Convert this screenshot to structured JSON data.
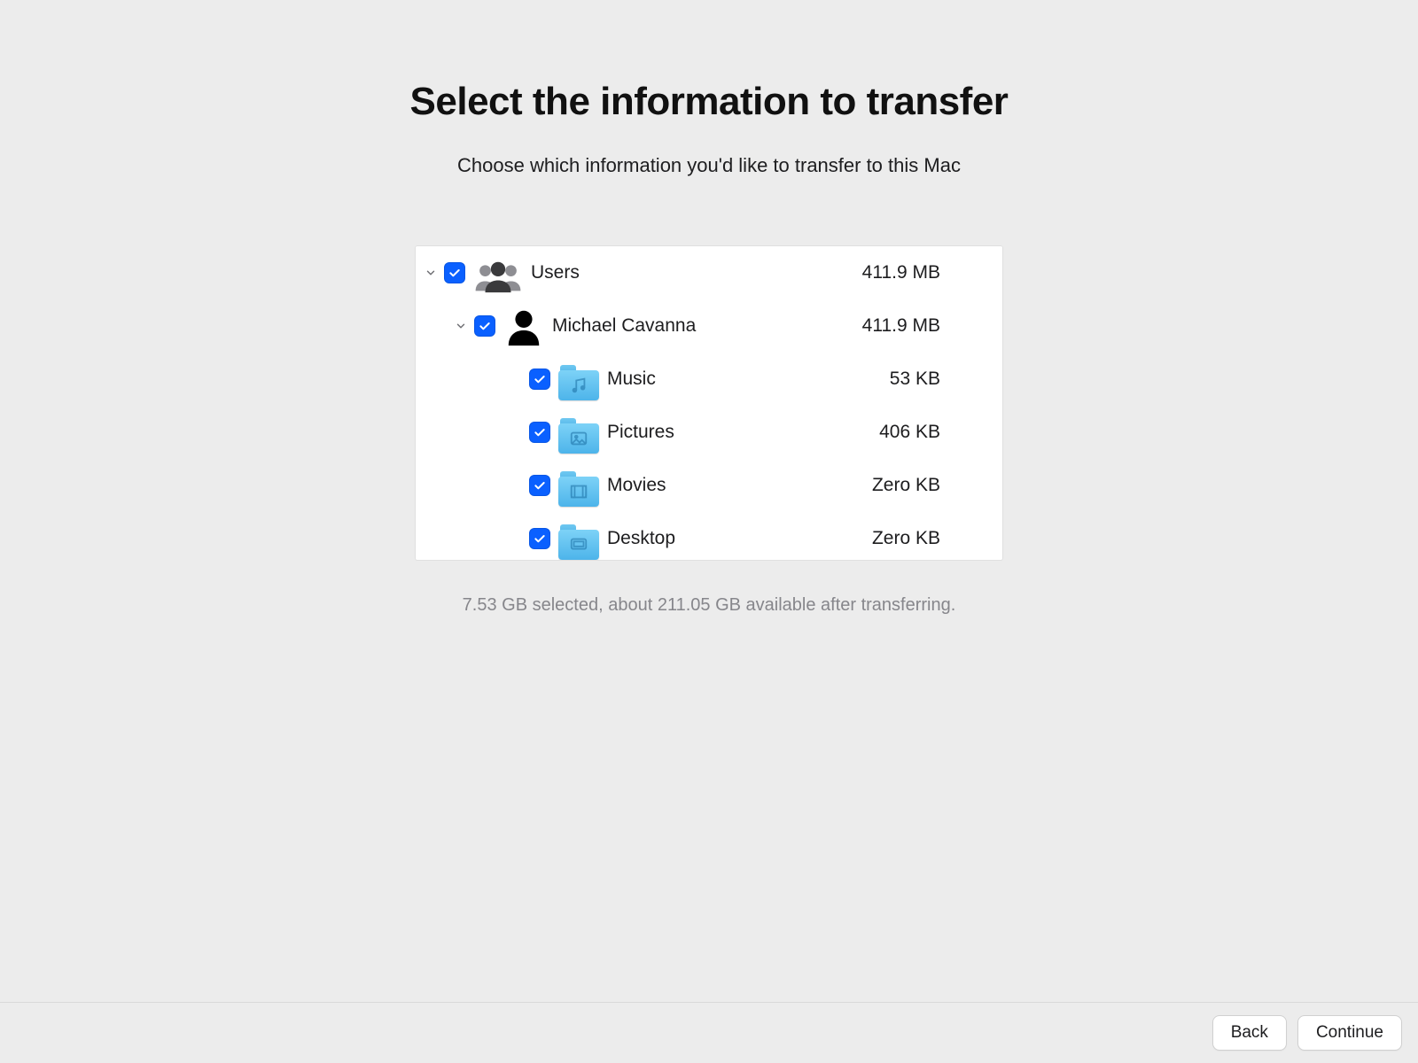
{
  "title": "Select the information to transfer",
  "subtitle": "Choose which information you'd like to transfer to this Mac",
  "tree": {
    "users": {
      "label": "Users",
      "size": "411.9 MB"
    },
    "user": {
      "label": "Michael Cavanna",
      "size": "411.9 MB"
    },
    "folders": [
      {
        "label": "Music",
        "size": "53 KB",
        "glyph": "music"
      },
      {
        "label": "Pictures",
        "size": "406 KB",
        "glyph": "pictures"
      },
      {
        "label": "Movies",
        "size": "Zero KB",
        "glyph": "movies"
      },
      {
        "label": "Desktop",
        "size": "Zero KB",
        "glyph": "desktop"
      }
    ]
  },
  "status": "7.53 GB selected, about 211.05 GB available after transferring.",
  "buttons": {
    "back": "Back",
    "continue": "Continue"
  }
}
